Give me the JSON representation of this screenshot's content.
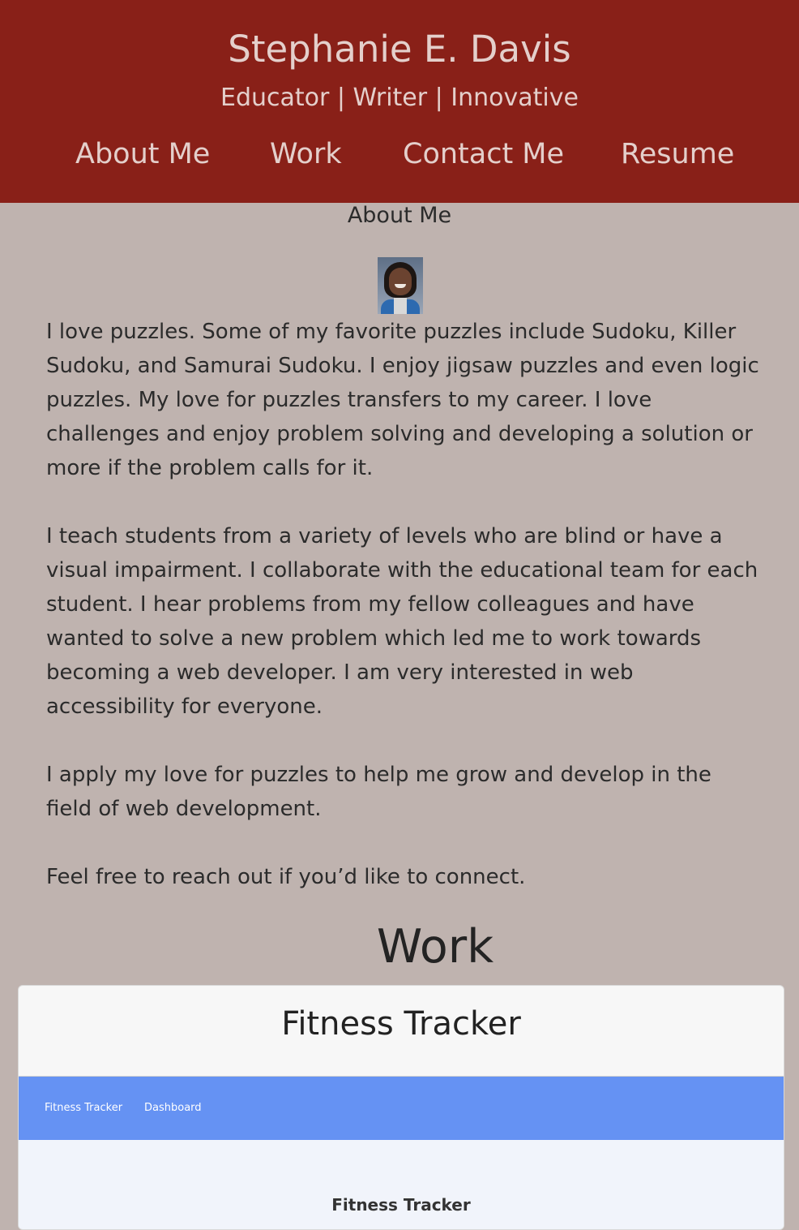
{
  "header": {
    "name": "Stephanie E. Davis",
    "tagline": "Educator | Writer | Innovative",
    "nav": [
      "About Me",
      "Work",
      "Contact Me",
      "Resume"
    ]
  },
  "about": {
    "heading": "About Me",
    "paragraphs": [
      "I love puzzles. Some of my favorite puzzles include Sudoku, Killer Sudoku, and Samurai Sudoku. I enjoy jigsaw puzzles and even logic puzzles. My love for puzzles transfers to my career. I love challenges and enjoy problem solving and developing a solution or more if the problem calls for it.",
      "I teach students from a variety of levels who are blind or have a visual impairment. I collaborate with the educational team for each student. I hear problems from my fellow colleagues and have wanted to solve a new problem which led me to work towards becoming a web developer. I am very interested in web accessibility for everyone.",
      "I apply my love for puzzles to help me grow and develop in the field of web development.",
      "Feel free to reach out if you’d like to connect."
    ]
  },
  "work": {
    "heading": "Work",
    "projects": [
      {
        "title": "Fitness Tracker",
        "screenshot": {
          "nav_brand": "Fitness Tracker",
          "nav_link": "Dashboard",
          "heading": "Fitness Tracker"
        }
      }
    ]
  },
  "colors": {
    "header_bg": "#892018",
    "page_bg": "#bfb3af",
    "header_text": "#e4cfcb",
    "screenshot_nav_bg": "#6592f3"
  }
}
